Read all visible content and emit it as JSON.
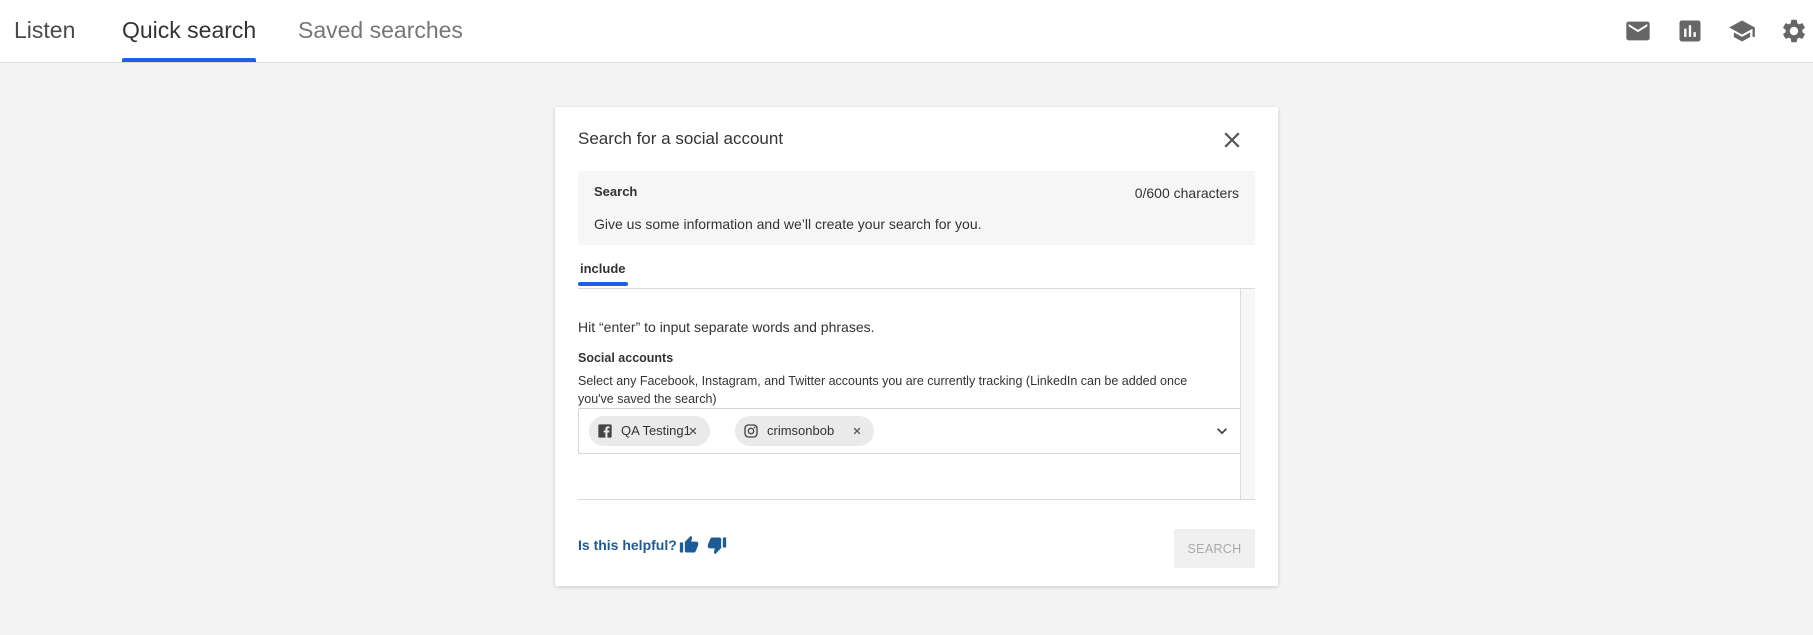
{
  "nav": {
    "tabs": [
      {
        "label": "Listen",
        "state": "default"
      },
      {
        "label": "Quick search",
        "state": "active"
      },
      {
        "label": "Saved searches",
        "state": "inactive"
      }
    ],
    "icons": [
      "mail-icon",
      "analytics-icon",
      "school-icon",
      "gear-icon"
    ]
  },
  "modal": {
    "title": "Search for a social account",
    "info": {
      "title": "Search",
      "count": "0/600 characters",
      "description": "Give us some information and we’ll create your search for you."
    },
    "tab": "include",
    "hint": "Hit “enter” to input separate words and phrases.",
    "field": {
      "label": "Social accounts",
      "description": "Select any Facebook, Instagram, and Twitter accounts you are currently tracking (LinkedIn can be added once you've saved the search)",
      "chips": [
        {
          "network": "facebook",
          "label": "QA Testing1"
        },
        {
          "network": "instagram",
          "label": "crimsonbob"
        }
      ]
    },
    "helpful": "Is this helpful?",
    "search_button": "SEARCH"
  },
  "colors": {
    "accent": "#1f5ee5",
    "link": "#1d5b96",
    "background": "#f4f4f4"
  }
}
